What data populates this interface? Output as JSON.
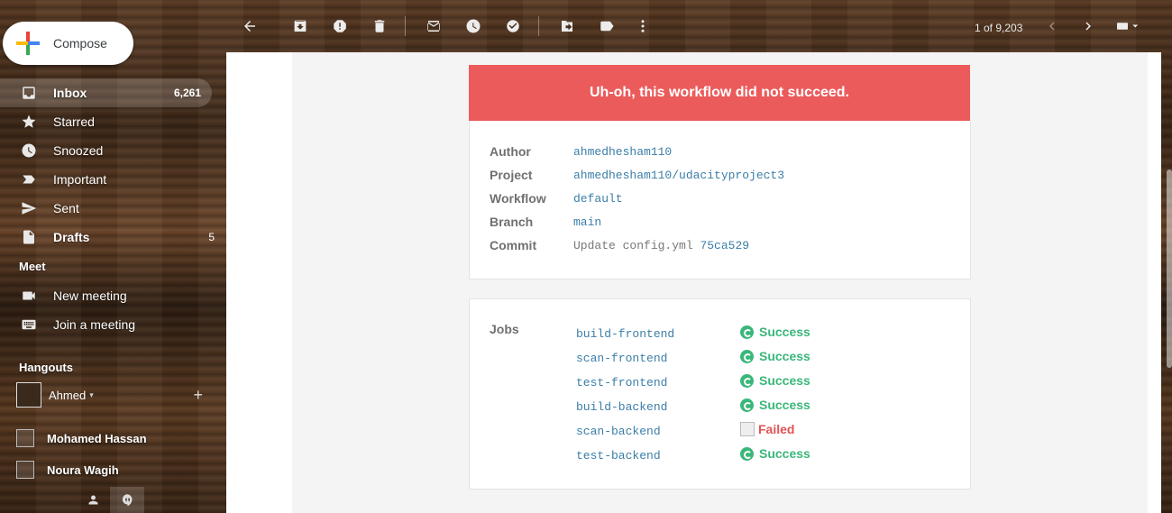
{
  "compose": {
    "label": "Compose"
  },
  "nav": {
    "items": [
      {
        "label": "Inbox",
        "count": "6,261",
        "icon": "inbox-icon",
        "active": true
      },
      {
        "label": "Starred",
        "count": "",
        "icon": "star-icon"
      },
      {
        "label": "Snoozed",
        "count": "",
        "icon": "clock-icon"
      },
      {
        "label": "Important",
        "count": "",
        "icon": "important-icon"
      },
      {
        "label": "Sent",
        "count": "",
        "icon": "send-icon"
      },
      {
        "label": "Drafts",
        "count": "5",
        "icon": "draft-icon"
      }
    ]
  },
  "meet": {
    "heading": "Meet",
    "new_meeting": "New meeting",
    "join_meeting": "Join a meeting"
  },
  "hangouts": {
    "heading": "Hangouts",
    "user": "Ahmed",
    "contacts": [
      {
        "name": "Mohamed Hassan"
      },
      {
        "name": "Noura Wagih"
      }
    ]
  },
  "toolbar": {
    "pager": "1 of 9,203",
    "icons": [
      "back-icon",
      "archive-icon",
      "report-spam-icon",
      "delete-icon",
      "mark-unread-icon",
      "snooze-icon",
      "add-task-icon",
      "move-to-icon",
      "label-icon",
      "more-icon",
      "prev-icon",
      "next-icon",
      "input-tools-icon"
    ]
  },
  "email": {
    "banner": "Uh-oh, this workflow did not succeed.",
    "details": {
      "author_label": "Author",
      "author": "ahmedhesham110",
      "project_label": "Project",
      "project": "ahmedhesham110/udacityproject3",
      "workflow_label": "Workflow",
      "workflow": "default",
      "branch_label": "Branch",
      "branch": "main",
      "commit_label": "Commit",
      "commit_msg": "Update config.yml",
      "commit_hash": "75ca529"
    },
    "jobs_label": "Jobs",
    "jobs": [
      {
        "name": "build-frontend",
        "status": "Success"
      },
      {
        "name": "scan-frontend",
        "status": "Success"
      },
      {
        "name": "test-frontend",
        "status": "Success"
      },
      {
        "name": "build-backend",
        "status": "Success"
      },
      {
        "name": "scan-backend",
        "status": "Failed"
      },
      {
        "name": "test-backend",
        "status": "Success"
      }
    ]
  },
  "colors": {
    "banner": "#ec5b5b",
    "success": "#3ab77a",
    "failed": "#e05454",
    "link": "#3b7ea8"
  }
}
